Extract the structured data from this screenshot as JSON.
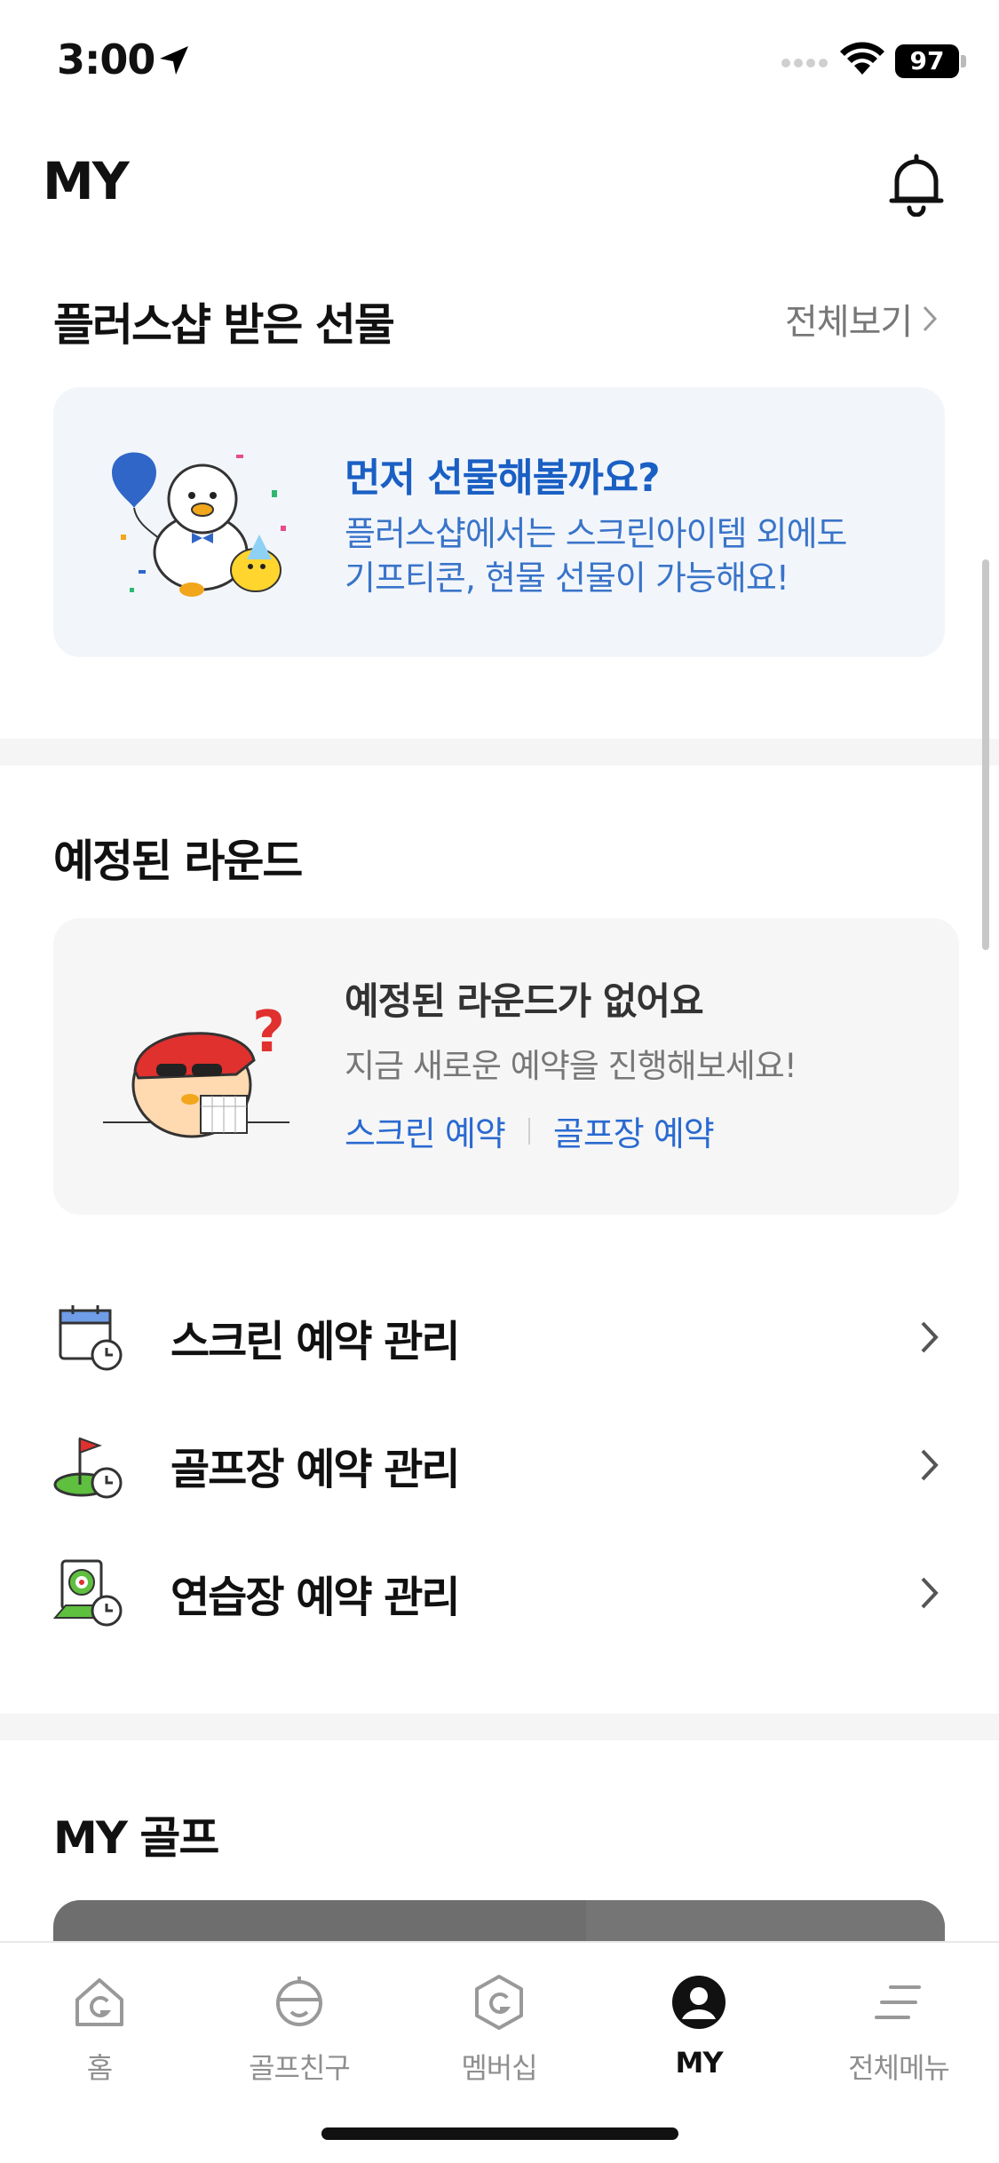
{
  "status_bar": {
    "time": "3:00",
    "battery": "97"
  },
  "header": {
    "title": "MY"
  },
  "gifts": {
    "title": "플러스샵 받은 선물",
    "see_all": "전체보기",
    "card_title": "먼저 선물해볼까요?",
    "card_desc_line1": "플러스샵에서는 스크린아이템 외에도",
    "card_desc_line2": "기프티콘, 현물 선물이 가능해요!"
  },
  "rounds": {
    "title": "예정된 라운드",
    "empty_title": "예정된 라운드가 없어요",
    "empty_desc": "지금 새로운 예약을 진행해보세요!",
    "link_screen": "스크린 예약",
    "link_golf": "골프장 예약"
  },
  "menu": {
    "items": [
      {
        "label": "스크린 예약 관리",
        "icon": "calendar-clock-icon"
      },
      {
        "label": "골프장 예약 관리",
        "icon": "golf-flag-clock-icon"
      },
      {
        "label": "연습장 예약 관리",
        "icon": "range-target-clock-icon"
      }
    ]
  },
  "my_golf": {
    "title": "MY 골프"
  },
  "tabbar": {
    "tabs": [
      {
        "label": "홈",
        "icon": "home-g-icon"
      },
      {
        "label": "골프친구",
        "icon": "golf-friend-icon"
      },
      {
        "label": "멤버십",
        "icon": "membership-g-icon"
      },
      {
        "label": "MY",
        "icon": "profile-icon"
      },
      {
        "label": "전체메뉴",
        "icon": "menu-lines-icon"
      }
    ],
    "active": "MY"
  },
  "colors": {
    "accent_blue": "#1a5fc4",
    "link_blue": "#2a6ad0",
    "gift_card_bg": "#f2f6fb",
    "round_card_bg": "#f6f6f6"
  }
}
